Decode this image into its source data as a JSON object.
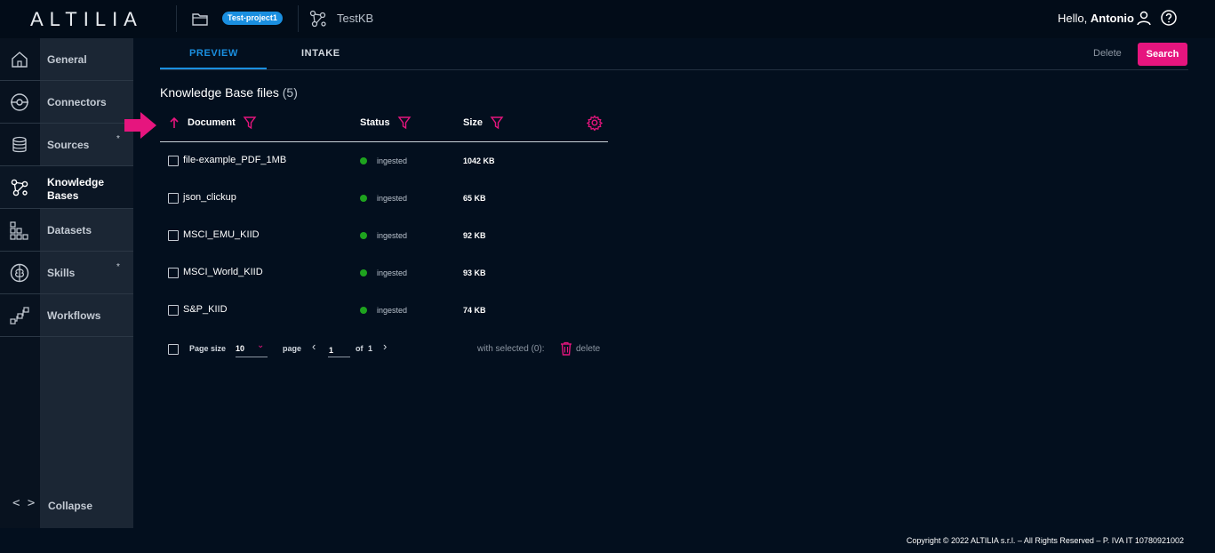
{
  "header": {
    "logo": "ALTILIA",
    "project_badge": "Test-project1",
    "kb_name": "TestKB",
    "greeting_prefix": "Hello,",
    "user_name": "Antonio"
  },
  "sidebar": {
    "items": [
      {
        "label": "General",
        "icon": "home-icon"
      },
      {
        "label": "Connectors",
        "icon": "connector-icon"
      },
      {
        "label": "Sources",
        "icon": "database-icon",
        "star": "*"
      },
      {
        "label": "Knowledge Bases",
        "icon": "graph-icon"
      },
      {
        "label": "Datasets",
        "icon": "grid-icon"
      },
      {
        "label": "Skills",
        "icon": "brain-icon",
        "star": "*"
      },
      {
        "label": "Workflows",
        "icon": "workflow-icon"
      }
    ],
    "collapse_label": "Collapse"
  },
  "tabs": [
    {
      "label": "PREVIEW"
    },
    {
      "label": "INTAKE"
    }
  ],
  "toolbar": {
    "delete_label": "Delete",
    "search_label": "Search"
  },
  "section": {
    "title": "Knowledge Base files",
    "count": "(5)"
  },
  "table": {
    "columns": [
      "Document",
      "Status",
      "Size"
    ],
    "rows": [
      {
        "document": "file-example_PDF_1MB",
        "status": "ingested",
        "size": "1042 KB"
      },
      {
        "document": "json_clickup",
        "status": "ingested",
        "size": "65 KB"
      },
      {
        "document": "MSCI_EMU_KIID",
        "status": "ingested",
        "size": "92 KB"
      },
      {
        "document": "MSCI_World_KIID",
        "status": "ingested",
        "size": "93 KB"
      },
      {
        "document": "S&P_KIID",
        "status": "ingested",
        "size": "74 KB"
      }
    ]
  },
  "pager": {
    "page_size_label": "Page size",
    "page_size_value": "10",
    "page_label": "page",
    "page_value": "1",
    "of_label": "of",
    "total_pages": "1",
    "with_selected": "with selected (0):",
    "delete_label": "delete"
  },
  "footer": {
    "copyright": "Copyright © 2022 ALTILIA s.r.l. – All Rights Reserved – P. IVA IT 10780921002"
  },
  "colors": {
    "accent": "#e6157e",
    "primary": "#1a8fe0",
    "status_ok": "#1ea31e",
    "background": "#030f1e"
  }
}
